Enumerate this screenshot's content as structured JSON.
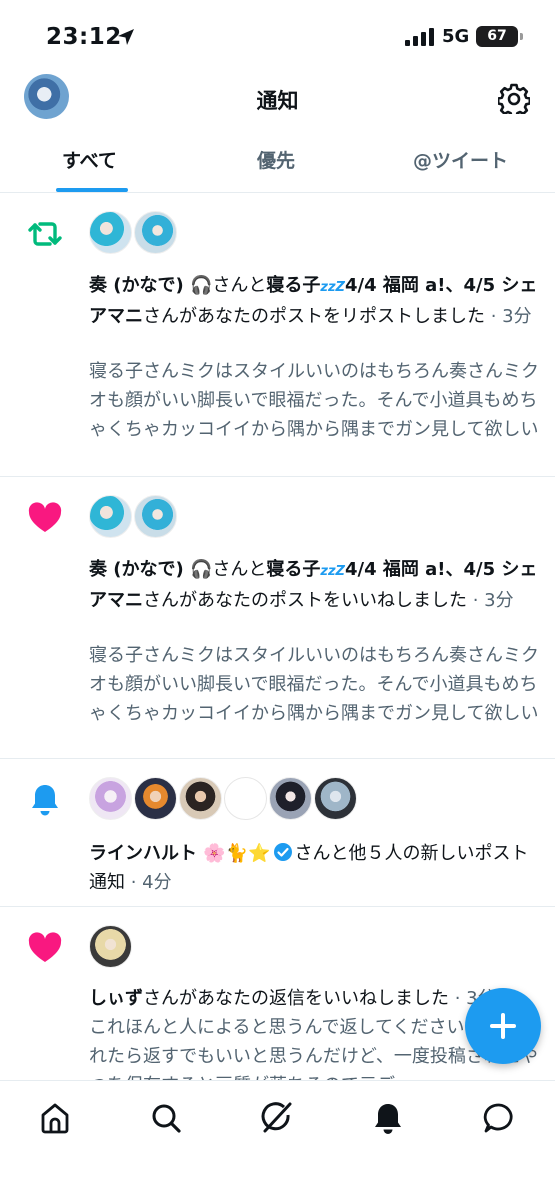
{
  "status_bar": {
    "time": "23:12",
    "network": "5G",
    "battery": "67",
    "battery_level": 0.67
  },
  "header": {
    "title": "通知"
  },
  "tabs": [
    {
      "label": "すべて",
      "active": true
    },
    {
      "label": "優先",
      "active": false
    },
    {
      "label": "@ツイート",
      "active": false
    }
  ],
  "notifications": [
    {
      "type": "repost",
      "icon": "repost-icon",
      "names": "奏 (かなで) 🎧",
      "connector": "さんと",
      "names2": "寝る子",
      "names2_zzz": "zzZ",
      "names2_rest": "4/4 福岡 a!、4/5 シェアマニ",
      "action": "さんがあなたのポストをリポストしました",
      "time": " · 3分",
      "body": "寝る子さんミクはスタイルいいのはもちろん奏さんミクオも顔がいい脚長いで眼福だった。そんで小道具もめちゃくちゃカッコイイから隅から隅までガン見して欲しい"
    },
    {
      "type": "like",
      "icon": "heart-icon",
      "names": "奏 (かなで) 🎧",
      "connector": "さんと",
      "names2": "寝る子",
      "names2_zzz": "zzZ",
      "names2_rest": "4/4 福岡 a!、4/5 シェアマニ",
      "action": "さんがあなたのポストをいいねしました",
      "time": " · 3分",
      "body": "寝る子さんミクはスタイルいいのはもちろん奏さんミクオも顔がいい脚長いで眼福だった。そんで小道具もめちゃくちゃカッコイイから隅から隅までガン見して欲しい"
    },
    {
      "type": "post-notification",
      "icon": "bell-icon",
      "names": "ラインハルト 🌸🐈⭐",
      "action": "さんと他５人の新しいポスト通知",
      "time": " · 4分"
    },
    {
      "type": "like",
      "icon": "heart-icon",
      "names": "しぃず",
      "action": "さんがあなたの返信をいいねしました",
      "time": " · 3分",
      "body": "これほんと人によると思うんで返してくださいって言われたら返すでもいいと思うんだけど、一度投稿されたやつを保存すると画質が落ちるので元デ"
    }
  ],
  "colors": {
    "accent": "#1d9bf0",
    "like": "#f91880",
    "repost": "#00ba7c"
  }
}
